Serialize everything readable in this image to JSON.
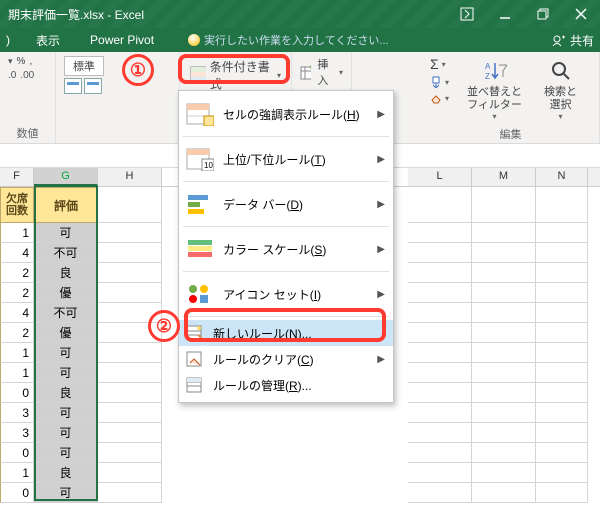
{
  "window": {
    "title": "期末評価一覧.xlsx - Excel",
    "share": "共有"
  },
  "tabs": {
    "view": "表示",
    "powerpivot": "Power Pivot",
    "tell_placeholder": "実行したい作業を入力してください..."
  },
  "ribbon": {
    "style_std": "標準",
    "cf_label": "条件付き書式",
    "insert": "挿入",
    "sort_filter": "並べ替えと\nフィルター",
    "find_select": "検索と\n選択",
    "group_number": "数値",
    "group_edit": "編集"
  },
  "menu": {
    "highlight": "セルの強調表示ルール(H)",
    "toprank": "上位/下位ルール(T)",
    "databar": "データ バー(D)",
    "colorscale": "カラー スケール(S)",
    "iconset": "アイコン セット(I)",
    "newrule": "新しいルール(N)...",
    "clear": "ルールのクリア(C)",
    "manage": "ルールの管理(R)..."
  },
  "columns": {
    "letters": [
      "F",
      "G",
      "H",
      "L",
      "M",
      "N"
    ],
    "f_header": "欠席\n回数",
    "g_header": "評価"
  },
  "data_rows": [
    {
      "f": "1",
      "g": "可"
    },
    {
      "f": "4",
      "g": "不可"
    },
    {
      "f": "2",
      "g": "良"
    },
    {
      "f": "2",
      "g": "優"
    },
    {
      "f": "4",
      "g": "不可"
    },
    {
      "f": "2",
      "g": "優"
    },
    {
      "f": "1",
      "g": "可"
    },
    {
      "f": "1",
      "g": "可"
    },
    {
      "f": "0",
      "g": "良"
    },
    {
      "f": "3",
      "g": "可"
    },
    {
      "f": "3",
      "g": "可"
    },
    {
      "f": "0",
      "g": "可"
    },
    {
      "f": "1",
      "g": "良"
    },
    {
      "f": "0",
      "g": "可"
    }
  ],
  "callouts": {
    "one": "①",
    "two": "②"
  }
}
